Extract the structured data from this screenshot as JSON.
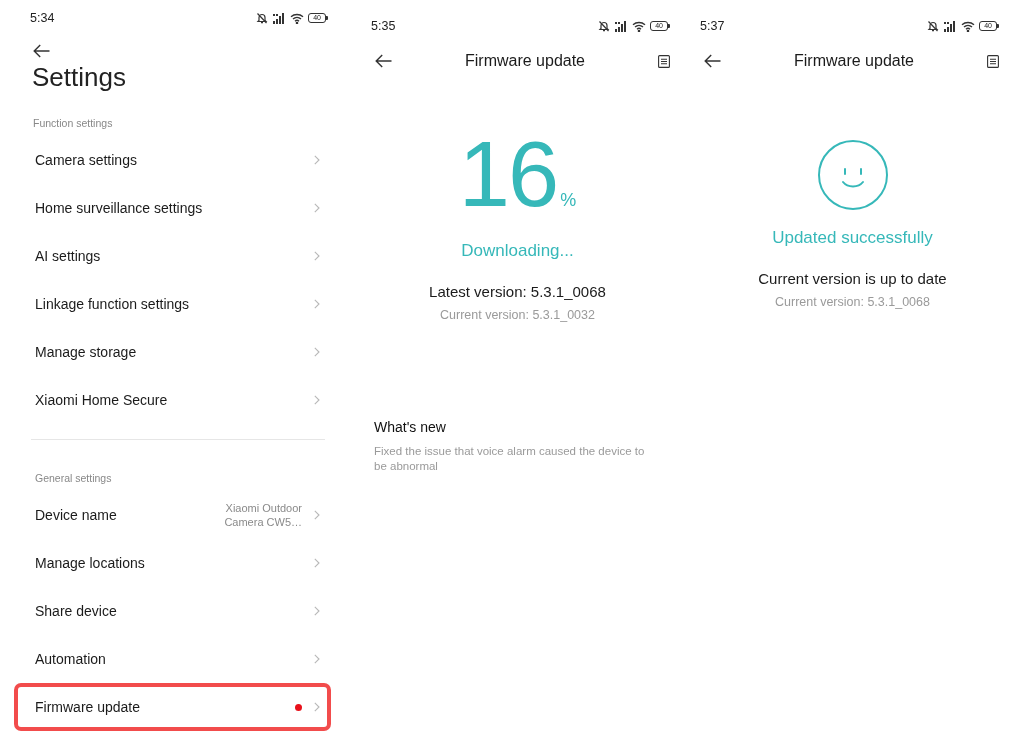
{
  "screens": [
    {
      "kind": "settings",
      "status_bar": {
        "time": "5:34",
        "battery": "40"
      },
      "title": "Settings",
      "sections": [
        {
          "heading": "Function settings",
          "items": [
            {
              "label": "Camera settings",
              "new_dot": false,
              "highlighted": false
            },
            {
              "label": "Home surveillance settings",
              "new_dot": false,
              "highlighted": false
            },
            {
              "label": "AI settings",
              "new_dot": false,
              "highlighted": false
            },
            {
              "label": "Linkage function settings",
              "new_dot": false,
              "highlighted": false
            },
            {
              "label": "Manage storage",
              "new_dot": false,
              "highlighted": false
            },
            {
              "label": "Xiaomi Home Secure",
              "new_dot": false,
              "highlighted": false
            }
          ]
        },
        {
          "heading": "General settings",
          "items": [
            {
              "label": "Device name",
              "value": "Xiaomi Outdoor Camera CW5…",
              "new_dot": false,
              "highlighted": false
            },
            {
              "label": "Manage locations",
              "new_dot": false,
              "highlighted": false
            },
            {
              "label": "Share device",
              "new_dot": false,
              "highlighted": false
            },
            {
              "label": "Automation",
              "new_dot": false,
              "highlighted": false
            },
            {
              "label": "Firmware update",
              "new_dot": true,
              "highlighted": true
            }
          ]
        }
      ]
    },
    {
      "kind": "downloading",
      "status_bar": {
        "time": "5:35",
        "battery": "40"
      },
      "title": "Firmware update",
      "percent": "16",
      "percent_sign": "%",
      "status": "Downloading...",
      "version_line": "Latest version: 5.3.1_0068",
      "current_version": "Current version: 5.3.1_0032",
      "whats_new": {
        "heading": "What's new",
        "text": "Fixed the issue that voice alarm caused the device to be abnormal"
      }
    },
    {
      "kind": "success",
      "status_bar": {
        "time": "5:37",
        "battery": "40"
      },
      "title": "Firmware update",
      "status": "Updated successfully",
      "version_line": "Current version is up to date",
      "current_version": "Current version: 5.3.1_0068"
    }
  ]
}
